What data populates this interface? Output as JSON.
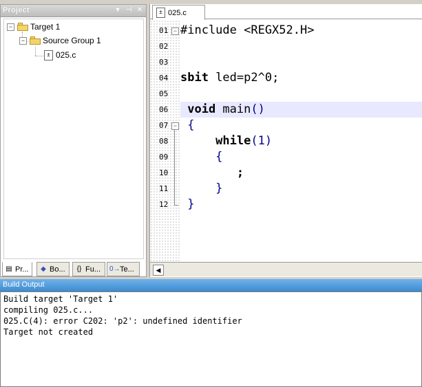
{
  "project": {
    "title": "Project",
    "title_buttons": [
      "▾",
      "⊣",
      "✕"
    ],
    "tree": {
      "target": "Target 1",
      "group": "Source Group 1",
      "file": "025.c"
    },
    "tabs": [
      {
        "label": "Pr...",
        "icon": "book-icon"
      },
      {
        "label": "Bo...",
        "icon": "books-icon"
      },
      {
        "label": "Fu...",
        "icon": "functions-icon"
      },
      {
        "label": "Te...",
        "icon": "templates-icon"
      }
    ]
  },
  "editor": {
    "tab_label": "025.c",
    "lines": [
      {
        "num": "01",
        "parts": [
          {
            "t": "#include <REGX52.H>",
            "c": "pre"
          }
        ]
      },
      {
        "num": "02",
        "parts": []
      },
      {
        "num": "03",
        "parts": []
      },
      {
        "num": "04",
        "parts": [
          {
            "t": "sbit",
            "c": "kw"
          },
          {
            "t": " led=p2^0;",
            "c": ""
          }
        ]
      },
      {
        "num": "05",
        "parts": []
      },
      {
        "num": "06",
        "parts": [
          {
            "t": " void",
            "c": "kw"
          },
          {
            "t": " main",
            "c": ""
          },
          {
            "t": "()",
            "c": "pn"
          }
        ]
      },
      {
        "num": "07",
        "parts": [
          {
            "t": " {",
            "c": "pn"
          }
        ]
      },
      {
        "num": "08",
        "parts": [
          {
            "t": "     while",
            "c": "kw"
          },
          {
            "t": "(1)",
            "c": "pn"
          }
        ]
      },
      {
        "num": "09",
        "parts": [
          {
            "t": "     {",
            "c": "pn"
          }
        ]
      },
      {
        "num": "10",
        "parts": [
          {
            "t": "        ;",
            "c": "kw"
          }
        ]
      },
      {
        "num": "11",
        "parts": [
          {
            "t": "     }",
            "c": "pn"
          }
        ]
      },
      {
        "num": "12",
        "parts": [
          {
            "t": " }",
            "c": "pn"
          }
        ]
      }
    ]
  },
  "build": {
    "title": "Build Output",
    "lines": [
      "Build target 'Target 1'",
      "compiling 025.c...",
      "025.C(4): error C202: 'p2': undefined identifier",
      "Target not created"
    ]
  }
}
